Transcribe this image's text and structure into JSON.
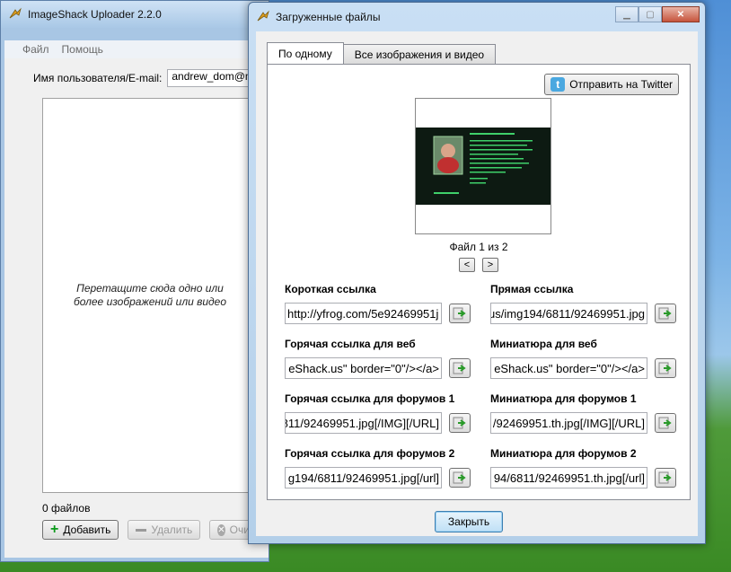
{
  "main_window": {
    "title": "ImageShack Uploader 2.2.0",
    "menu": [
      "Файл",
      "Помощь"
    ],
    "user_label": "Имя пользователя/E-mail:",
    "user_value": "andrew_dom@mail.ru",
    "dropzone_text": "Перетащите сюда одно или более изображений или видео",
    "files_count": "0 файлов",
    "buttons": {
      "add": "Добавить",
      "delete": "Удалить",
      "clear": "Очис"
    }
  },
  "dialog": {
    "title": "Загруженные файлы",
    "tabs": [
      "По одному",
      "Все изображения и видео"
    ],
    "twitter_button": "Отправить на Twitter",
    "file_counter": "Файл 1 из 2",
    "prev": "<",
    "next": ">",
    "fields": [
      {
        "label": "Короткая ссылка",
        "value": "http://yfrog.com/5e92469951j"
      },
      {
        "label": "Прямая ссылка",
        "value": "us/img194/6811/92469951.jpg"
      },
      {
        "label": "Горячая ссылка для веб",
        "value": "eShack.us\" border=\"0\"/></a>"
      },
      {
        "label": "Миниатюра для веб",
        "value": "eShack.us\" border=\"0\"/></a>"
      },
      {
        "label": "Горячая ссылка для форумов 1",
        "value": "811/92469951.jpg[/IMG][/URL]"
      },
      {
        "label": "Миниатюра для форумов 1",
        "value": "/92469951.th.jpg[/IMG][/URL]"
      },
      {
        "label": "Горячая ссылка для форумов 2",
        "value": "g194/6811/92469951.jpg[/url]"
      },
      {
        "label": "Миниатюра для форумов 2",
        "value": "94/6811/92469951.th.jpg[/url]"
      }
    ],
    "close_button": "Закрыть"
  }
}
